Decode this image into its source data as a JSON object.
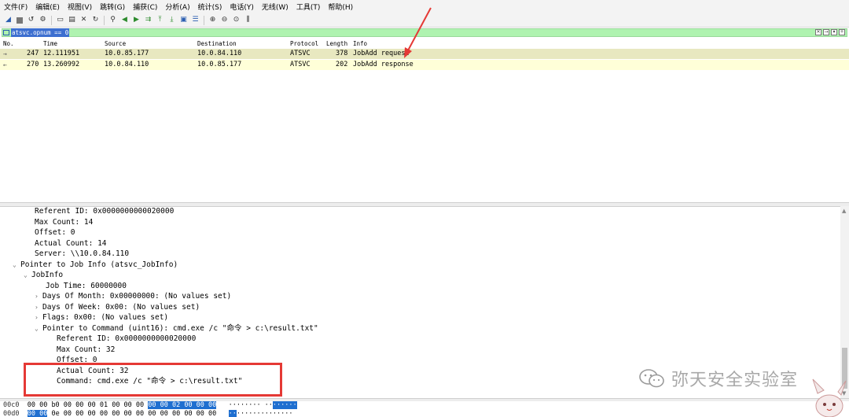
{
  "menu": [
    "文件(F)",
    "编辑(E)",
    "视图(V)",
    "跳转(G)",
    "捕获(C)",
    "分析(A)",
    "统计(S)",
    "电话(Y)",
    "无线(W)",
    "工具(T)",
    "帮助(H)"
  ],
  "filter": {
    "text": "atsvc.opnum == 0"
  },
  "packet_list": {
    "headers": [
      "No.",
      "Time",
      "Source",
      "Destination",
      "Protocol",
      "Length",
      "Info"
    ],
    "rows": [
      {
        "no": "247",
        "time": "12.111951",
        "src": "10.0.85.177",
        "dst": "10.0.84.110",
        "proto": "ATSVC",
        "len": "378",
        "info": "JobAdd request"
      },
      {
        "no": "270",
        "time": "13.260992",
        "src": "10.0.84.110",
        "dst": "10.0.85.177",
        "proto": "ATSVC",
        "len": "202",
        "info": "JobAdd response"
      }
    ]
  },
  "details": [
    "Referent ID: 0x0000000000020000",
    "Max Count: 14",
    "Offset: 0",
    "Actual Count: 14",
    "Server: \\\\10.0.84.110",
    "Pointer to Job Info (atsvc_JobInfo)",
    "JobInfo",
    "Job Time: 60000000",
    "Days Of Month: 0x00000000: (No values set)",
    "Days Of Week: 0x00: (No values set)",
    "Flags: 0x00: (No values set)",
    "Pointer to Command (uint16): cmd.exe /c \"命令 > c:\\result.txt\"",
    "Referent ID: 0x0000000000020000",
    "Max Count: 32",
    "Offset: 0",
    "Actual Count: 32",
    "Command: cmd.exe /c \"命令 > c:\\result.txt\""
  ],
  "hex": {
    "row1": {
      "offset": "00c0",
      "plain": "00 00 b0 00 00 00 01 00  00 00 ",
      "selected": "00 00 02 00 00 00",
      "ascii_plain": "········ ··",
      "ascii_sel": "······"
    },
    "row2": {
      "offset": "00d0",
      "selected": "00 00",
      "plain": " 0e 00 00 00 00 00 00 00  00 00 00 00 00 00",
      "ascii_sel": "··",
      "ascii_plain": "··············"
    }
  },
  "watermark": "弥天安全实验室"
}
